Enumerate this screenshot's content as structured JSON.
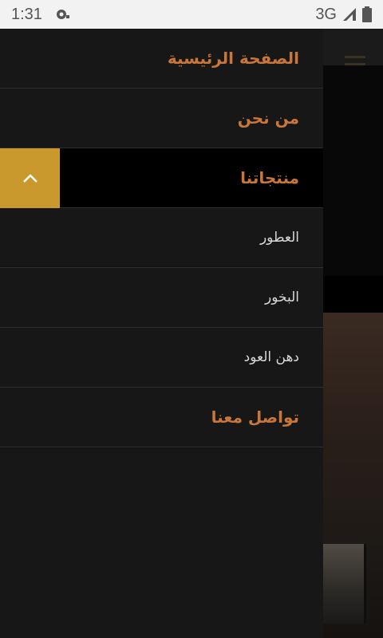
{
  "status_bar": {
    "time": "1:31",
    "network": "3G"
  },
  "colors": {
    "accent": "#c8763a",
    "toggle_bg": "#c9992e",
    "drawer_bg": "#171717"
  },
  "drawer": {
    "items": [
      {
        "label": "الصفحة الرئيسية"
      },
      {
        "label": "من نحن"
      },
      {
        "label": "منتجاتنا",
        "expanded": true
      },
      {
        "label": "العطور"
      },
      {
        "label": "البخور"
      },
      {
        "label": "دهن العود"
      },
      {
        "label": "تواصل معنا"
      }
    ]
  },
  "icons": {
    "menu": "hamburger-icon",
    "collapse": "chevron-up-icon",
    "notification": "notification-icon",
    "signal": "signal-icon",
    "battery": "battery-icon"
  }
}
